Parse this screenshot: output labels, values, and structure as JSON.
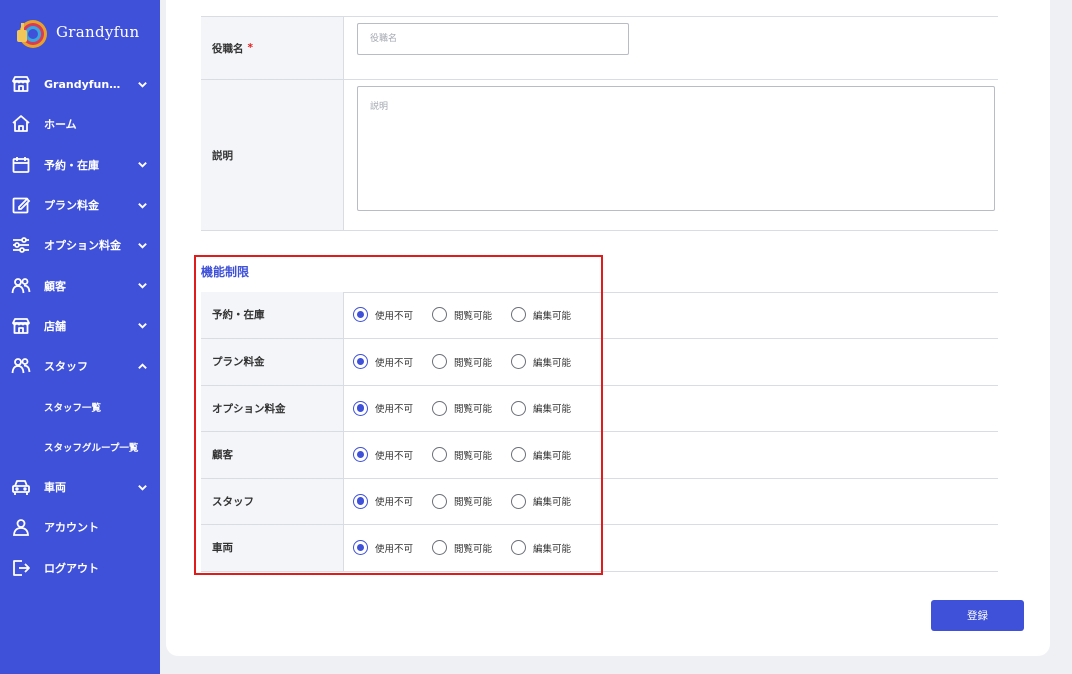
{
  "brand": {
    "name": "Grandyfun"
  },
  "sidebar": {
    "items": [
      {
        "label": "Grandyfun…",
        "icon": "store-icon",
        "has_chevron": true,
        "expanded": false
      },
      {
        "label": "ホーム",
        "icon": "home-icon",
        "has_chevron": false
      },
      {
        "label": "予約・在庫",
        "icon": "calendar-icon",
        "has_chevron": true,
        "expanded": false
      },
      {
        "label": "プラン料金",
        "icon": "edit-icon",
        "has_chevron": true,
        "expanded": false
      },
      {
        "label": "オプション料金",
        "icon": "sliders-icon",
        "has_chevron": true,
        "expanded": false
      },
      {
        "label": "顧客",
        "icon": "users-icon",
        "has_chevron": true,
        "expanded": false
      },
      {
        "label": "店舗",
        "icon": "store-icon",
        "has_chevron": true,
        "expanded": false
      },
      {
        "label": "スタッフ",
        "icon": "users-icon",
        "has_chevron": true,
        "expanded": true
      },
      {
        "label": "スタッフ一覧",
        "sub": true
      },
      {
        "label": "スタッフグループ一覧",
        "sub": true
      },
      {
        "label": "車両",
        "icon": "car-icon",
        "has_chevron": true,
        "expanded": false
      },
      {
        "label": "アカウント",
        "icon": "user-icon",
        "has_chevron": false
      },
      {
        "label": "ログアウト",
        "icon": "logout-icon",
        "has_chevron": false
      }
    ]
  },
  "form": {
    "role_name": {
      "label": "役職名",
      "required_mark": "*",
      "placeholder": "役職名",
      "value": ""
    },
    "description": {
      "label": "説明",
      "placeholder": "説明",
      "value": ""
    }
  },
  "permissions": {
    "title": "機能制限",
    "options": [
      "使用不可",
      "閲覧可能",
      "編集可能"
    ],
    "rows": [
      {
        "label": "予約・在庫",
        "selected": "使用不可"
      },
      {
        "label": "プラン料金",
        "selected": "使用不可"
      },
      {
        "label": "オプション料金",
        "selected": "使用不可"
      },
      {
        "label": "顧客",
        "selected": "使用不可"
      },
      {
        "label": "スタッフ",
        "selected": "使用不可"
      },
      {
        "label": "車両",
        "selected": "使用不可"
      }
    ]
  },
  "actions": {
    "submit_label": "登録"
  },
  "colors": {
    "primary": "#3f51d8",
    "highlight": "#e01b1b",
    "required": "#e02020",
    "label_bg": "#f3f5f9"
  }
}
